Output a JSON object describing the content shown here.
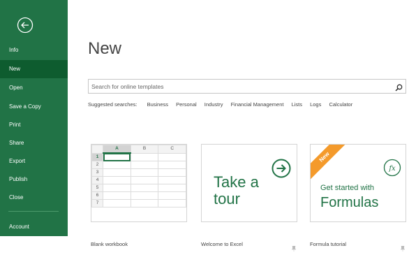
{
  "sidebar": {
    "items": [
      {
        "label": "Info"
      },
      {
        "label": "New"
      },
      {
        "label": "Open"
      },
      {
        "label": "Save a Copy"
      },
      {
        "label": "Print"
      },
      {
        "label": "Share"
      },
      {
        "label": "Export"
      },
      {
        "label": "Publish"
      },
      {
        "label": "Close"
      },
      {
        "label": "Account"
      }
    ],
    "active": "New",
    "color": "#217346",
    "active_color": "#0e5c2f"
  },
  "main": {
    "title": "New",
    "search": {
      "placeholder": "Search for online templates",
      "icon": "search-icon"
    },
    "suggested": {
      "label": "Suggested searches:",
      "items": [
        "Business",
        "Personal",
        "Industry",
        "Financial Management",
        "Lists",
        "Logs",
        "Calculator"
      ]
    },
    "templates": [
      {
        "label": "Blank workbook",
        "columns": [
          "A",
          "B",
          "C"
        ],
        "rows": [
          "1",
          "2",
          "3",
          "4",
          "5",
          "6",
          "7"
        ]
      },
      {
        "label": "Welcome to Excel",
        "text_line1": "Take a",
        "text_line2": "tour",
        "icon": "arrow-right-circle-icon"
      },
      {
        "label": "Formula tutorial",
        "badge": "New",
        "subtitle": "Get started with",
        "title": "Formulas",
        "icon": "fx-icon"
      }
    ],
    "accent": "#217346",
    "badge_color": "#f49a2b"
  }
}
